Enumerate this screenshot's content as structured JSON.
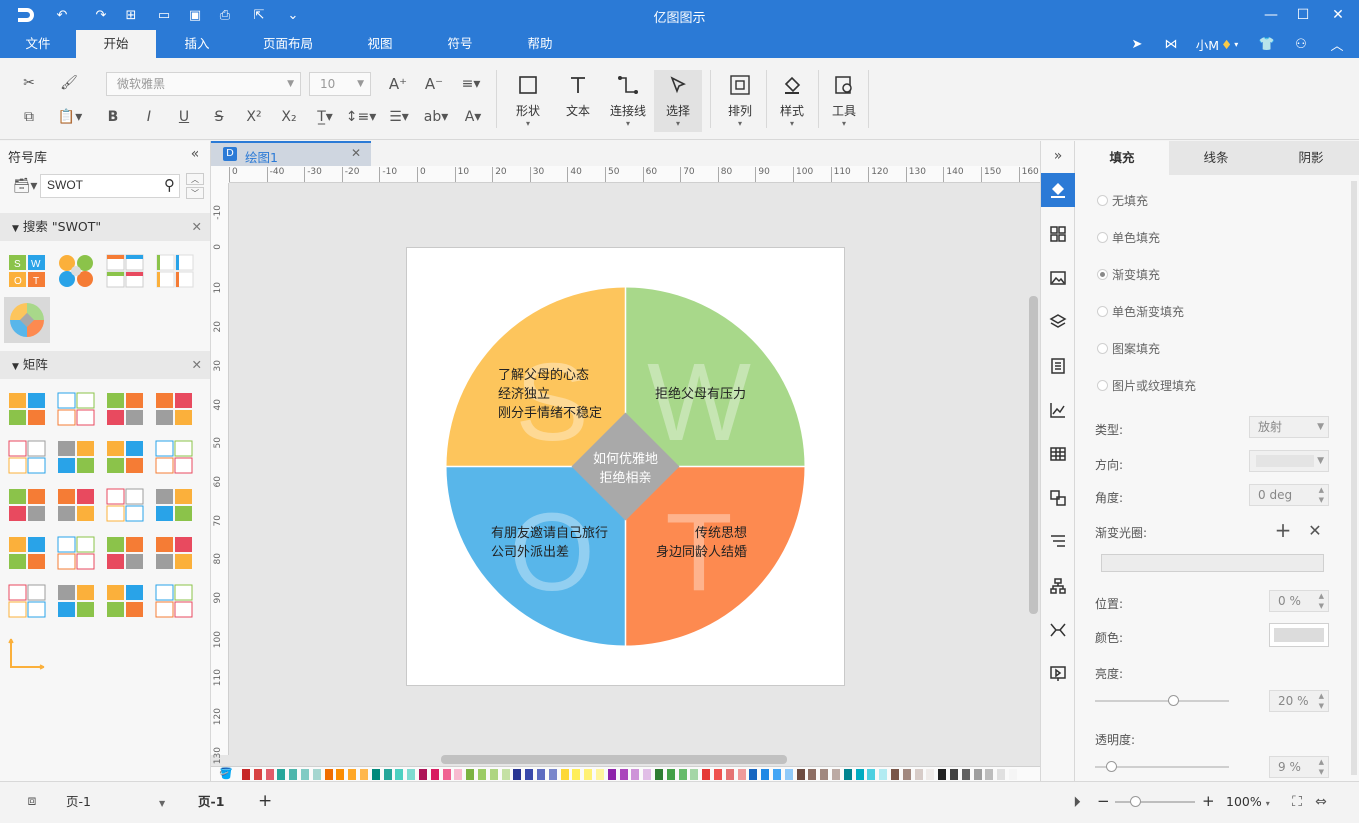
{
  "app": {
    "title": "亿图图示"
  },
  "menu": {
    "items": [
      "文件",
      "开始",
      "插入",
      "页面布局",
      "视图",
      "符号",
      "帮助"
    ],
    "user": "小M"
  },
  "ribbon": {
    "font_name": "微软雅黑",
    "font_size": "10",
    "shape_label": "形状",
    "text_label": "文本",
    "connector_label": "连接线",
    "select_label": "选择",
    "arrange_label": "排列",
    "style_label": "样式",
    "tools_label": "工具"
  },
  "library": {
    "title": "符号库",
    "search_value": "SWOT",
    "search_section": "搜索 \"SWOT\"",
    "matrix_section": "矩阵"
  },
  "document": {
    "tab_name": "绘图1",
    "ruler_h": [
      "0",
      "-40",
      "-30",
      "-20",
      "-10",
      "0",
      "10",
      "20",
      "30",
      "40",
      "50",
      "60",
      "70",
      "80",
      "90",
      "100",
      "110",
      "120",
      "130",
      "140",
      "150",
      "160"
    ],
    "ruler_v": [
      "-10",
      "0",
      "10",
      "20",
      "30",
      "40",
      "50",
      "60",
      "70",
      "80",
      "90",
      "100",
      "110",
      "120",
      "130"
    ]
  },
  "swot": {
    "s_letter": "S",
    "w_letter": "W",
    "o_letter": "O",
    "t_letter": "T",
    "s_text": [
      "了解父母的心态",
      "经济独立",
      "刚分手情绪不稳定"
    ],
    "w_text": [
      "拒绝父母有压力"
    ],
    "o_text": [
      "有朋友邀请自己旅行",
      "公司外派出差"
    ],
    "t_text": [
      "传统思想",
      "身边同龄人结婚"
    ],
    "center": [
      "如何优雅地",
      "拒绝相亲"
    ],
    "colors": {
      "s": "#fdc55c",
      "w": "#a8d88a",
      "o": "#58b6ea",
      "t": "#fd8a50",
      "center": "#a9a9a9"
    }
  },
  "props": {
    "tabs": [
      "填充",
      "线条",
      "阴影"
    ],
    "fill_options": [
      "无填充",
      "单色填充",
      "渐变填充",
      "单色渐变填充",
      "图案填充",
      "图片或纹理填充"
    ],
    "selected_fill": "渐变填充",
    "type_label": "类型:",
    "type_value": "放射",
    "direction_label": "方向:",
    "angle_label": "角度:",
    "angle_value": "0 deg",
    "stops_label": "渐变光圈:",
    "position_label": "位置:",
    "position_value": "0 %",
    "color_label": "颜色:",
    "brightness_label": "亮度:",
    "brightness_value": "20 %",
    "transparency_label": "透明度:",
    "transparency_value": "9 %"
  },
  "status": {
    "page_select": "页-1",
    "page_tab": "页-1",
    "zoom": "100%"
  },
  "accent_color": "#2b7ad6"
}
